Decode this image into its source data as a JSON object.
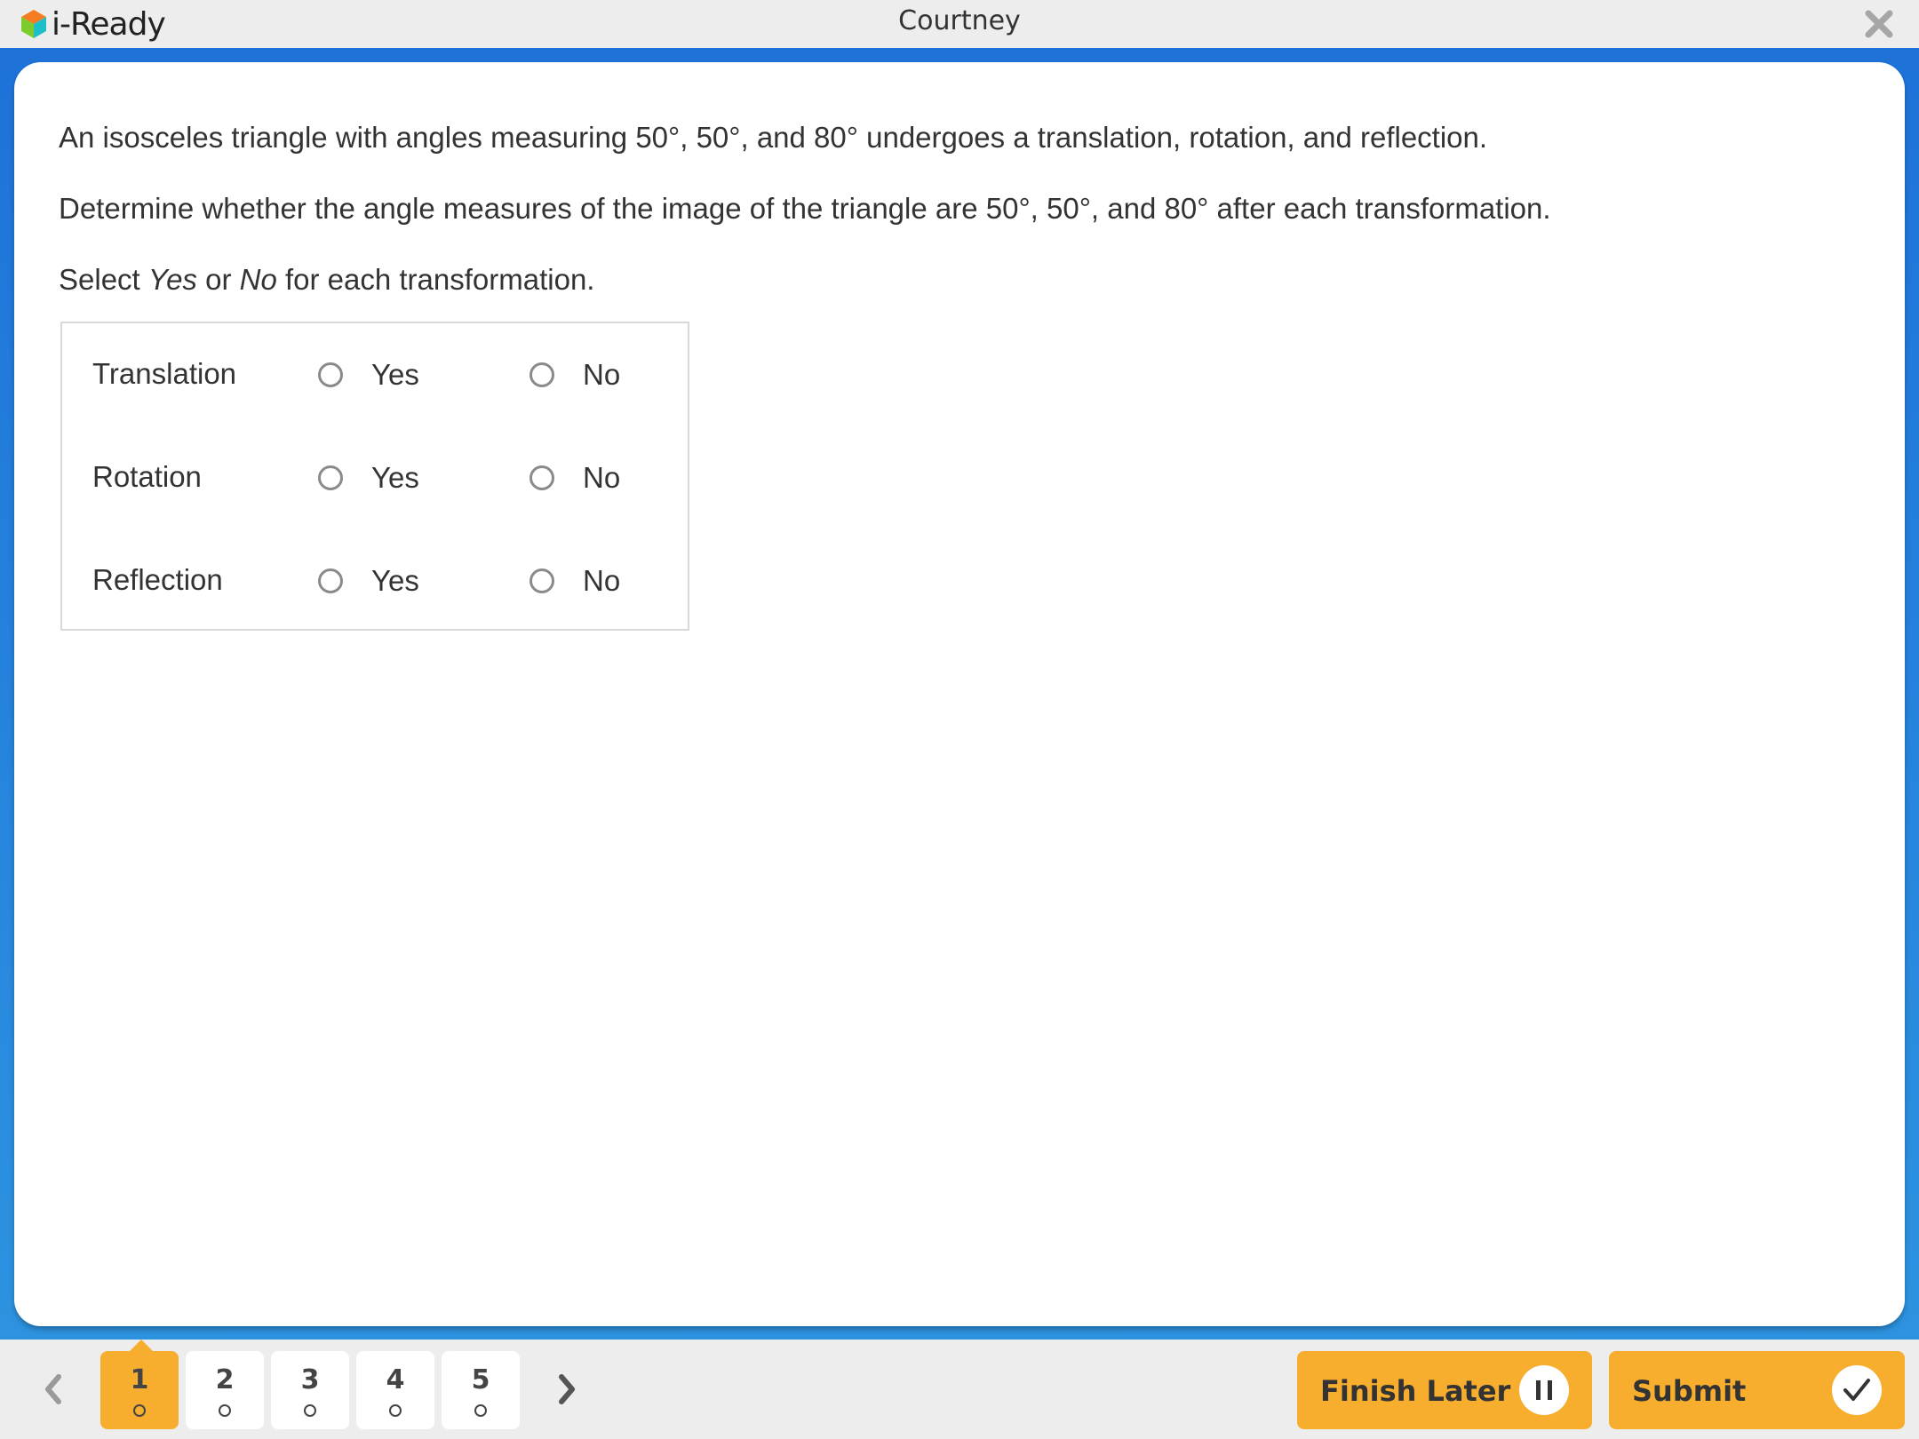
{
  "header": {
    "app_name": "i-Ready",
    "user_name": "Courtney"
  },
  "question": {
    "prompt": "An isosceles triangle with angles measuring 50°, 50°, and 80° undergoes a translation, rotation, and reflection.",
    "instruction": "Determine whether the angle measures of the image of the triangle are 50°, 50°, and 80° after each transformation.",
    "select_prefix": "Select ",
    "select_yes": "Yes",
    "select_or": " or ",
    "select_no": "No",
    "select_suffix": " for each transformation.",
    "rows": [
      {
        "label": "Translation",
        "yes": "Yes",
        "no": "No",
        "selected": null
      },
      {
        "label": "Rotation",
        "yes": "Yes",
        "no": "No",
        "selected": null
      },
      {
        "label": "Reflection",
        "yes": "Yes",
        "no": "No",
        "selected": null
      }
    ]
  },
  "footer": {
    "pages": [
      {
        "number": "1",
        "current": true
      },
      {
        "number": "2",
        "current": false
      },
      {
        "number": "3",
        "current": false
      },
      {
        "number": "4",
        "current": false
      },
      {
        "number": "5",
        "current": false
      }
    ],
    "finish_later_label": "Finish Later",
    "submit_label": "Submit"
  },
  "colors": {
    "accent_orange": "#f7ae2e",
    "blue": "#1e72d8"
  }
}
